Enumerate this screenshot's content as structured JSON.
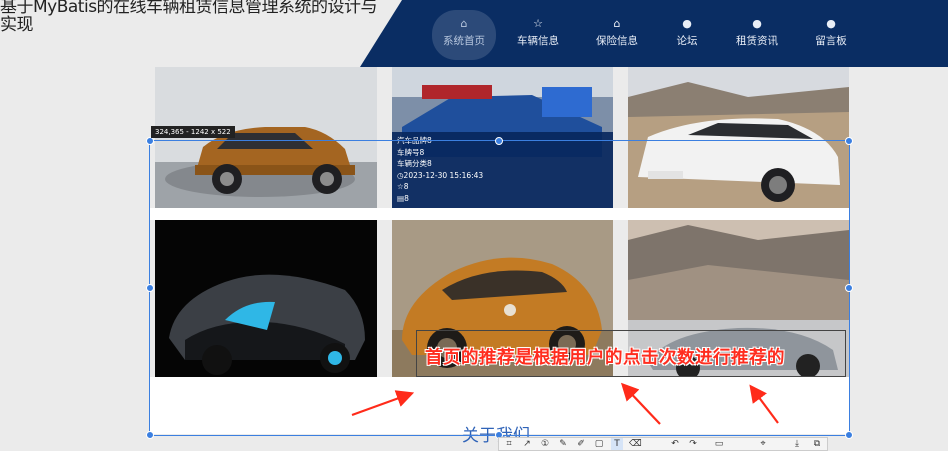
{
  "site": {
    "title": "基于MyBatis的在线车辆租赁信息管理系统的设计与实现"
  },
  "nav": {
    "items": [
      {
        "label": "系统首页",
        "icon": "home-icon",
        "active": true
      },
      {
        "label": "车辆信息",
        "icon": "star-icon"
      },
      {
        "label": "保险信息",
        "icon": "bag-icon"
      },
      {
        "label": "论坛",
        "icon": "info-icon"
      },
      {
        "label": "租赁资讯",
        "icon": "question-icon"
      },
      {
        "label": "留言板",
        "icon": "info-icon"
      }
    ]
  },
  "cards": [
    {
      "car": "orange SUV"
    },
    {
      "car": "blue sports car"
    },
    {
      "car": "white sedan"
    },
    {
      "car": "black hypercar"
    },
    {
      "car": "orange beetle"
    },
    {
      "car": "silver sports car"
    }
  ],
  "card_overlay": {
    "name": "汽车品牌8",
    "plate": "车牌号8",
    "category": "车辆分类8",
    "datetime": "2023-12-30 15:16:43",
    "likes": "8",
    "views": "8"
  },
  "capture": {
    "size_label": "324,365 - 1242 x 522"
  },
  "footer": {
    "about": "关于我们"
  },
  "annotation": {
    "text": "首页的推荐是根据用户的点击次数进行推荐的"
  },
  "toolbar": {
    "icons": [
      "crop-icon",
      "arrow-icon",
      "number-icon",
      "pen-icon",
      "pencil-icon",
      "rect-icon",
      "text-icon",
      "eraser-icon",
      "undo-icon",
      "redo-icon",
      "ocr-icon",
      "pin-icon",
      "save-icon",
      "copy-icon"
    ]
  }
}
